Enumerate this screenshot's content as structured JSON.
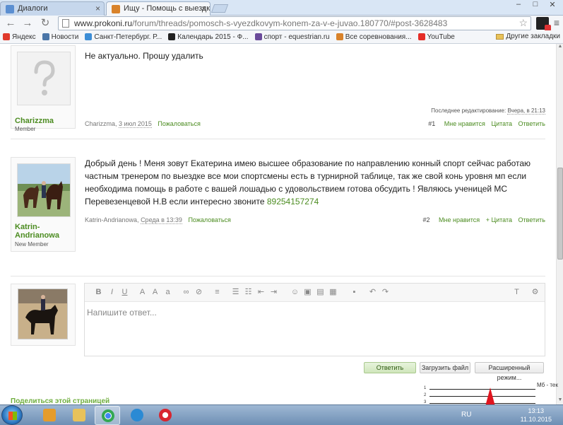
{
  "browser": {
    "tabs": [
      {
        "title": "Диалоги",
        "favicon_color": "#5b8fd1"
      },
      {
        "title": "Ищу - Помощь с выездко",
        "favicon_color": "#d9832b"
      }
    ],
    "url_host": "www.prokoni.ru",
    "url_path": "/forum/threads/pomosch-s-vyezdkovym-konem-za-v-e-juvao.180770/#post-3628483"
  },
  "bookmarks": {
    "items": [
      {
        "label": "Яндекс",
        "color": "#e03a2c"
      },
      {
        "label": "Новости",
        "color": "#4a76a8"
      },
      {
        "label": "Санкт-Петербург. Р...",
        "color": "#3c8dd6"
      },
      {
        "label": "Календарь 2015 - Ф...",
        "color": "#222222"
      },
      {
        "label": "спорт - equestrian.ru",
        "color": "#6a4a9a"
      },
      {
        "label": "Все соревнования...",
        "color": "#d9832b"
      },
      {
        "label": "YouTube",
        "color": "#e52d27"
      }
    ],
    "other": "Другие закладки"
  },
  "posts": [
    {
      "username": "Charizzma",
      "user_title": "Member",
      "message": "Не актуально. Прошу удалить",
      "edited_label": "Последнее редактирование:",
      "edited_date": "Вчера, в 21:13",
      "author": "Charizzma,",
      "date": "3 июл 2015",
      "report": "Пожаловаться",
      "number": "#1",
      "like": "Мне нравится",
      "quote": "Цитата",
      "reply": "Ответить"
    },
    {
      "username": "Katrin-Andrianowa",
      "user_title": "New Member",
      "message": "Добрый день ! Меня зовут Екатерина имею высшее образование по направлению конный спорт сейчас работаю частным тренером по выездке все мои спортсмены есть в турнирной таблице, так же свой конь уровня мп если необходима помощь в работе с вашей лошадью с удовольствием готова обсудить ! Являюсь ученицей МС Перевезенцевой Н.В если интересно звоните",
      "phone": "89254157274",
      "author": "Katrin-Andrianowa,",
      "date": "Среда в 13:39",
      "report": "Пожаловаться",
      "number": "#2",
      "like": "Мне нравится",
      "quote": "+ Цитата",
      "reply": "Ответить"
    }
  ],
  "editor": {
    "placeholder": "Напишите ответ...",
    "toolbar": [
      "B",
      "I",
      "U",
      "A",
      "A",
      "Aa",
      "link",
      "unlink",
      "align",
      "list-ul",
      "list-ol",
      "outdent",
      "indent",
      "smile",
      "image",
      "media",
      "code",
      "save",
      "undo",
      "redo",
      "Tx",
      "settings"
    ]
  },
  "buttons": {
    "reply": "Ответить",
    "upload": "Загрузить файл",
    "advanced": "Расширенный режим..."
  },
  "share_label": "Поделиться этой страницей",
  "taskbar": {
    "apps": [
      {
        "name": "media-player",
        "color": "#e59c2b"
      },
      {
        "name": "explorer",
        "color": "#e8c25a"
      },
      {
        "name": "chrome",
        "color": "#4caf50"
      },
      {
        "name": "internet-explorer",
        "color": "#2a8ad4"
      },
      {
        "name": "opera",
        "color": "#d8252f"
      }
    ],
    "language": "RU",
    "time": "13:13",
    "date": "11.10.2015"
  },
  "meter": {
    "label": "Мб - тек"
  }
}
